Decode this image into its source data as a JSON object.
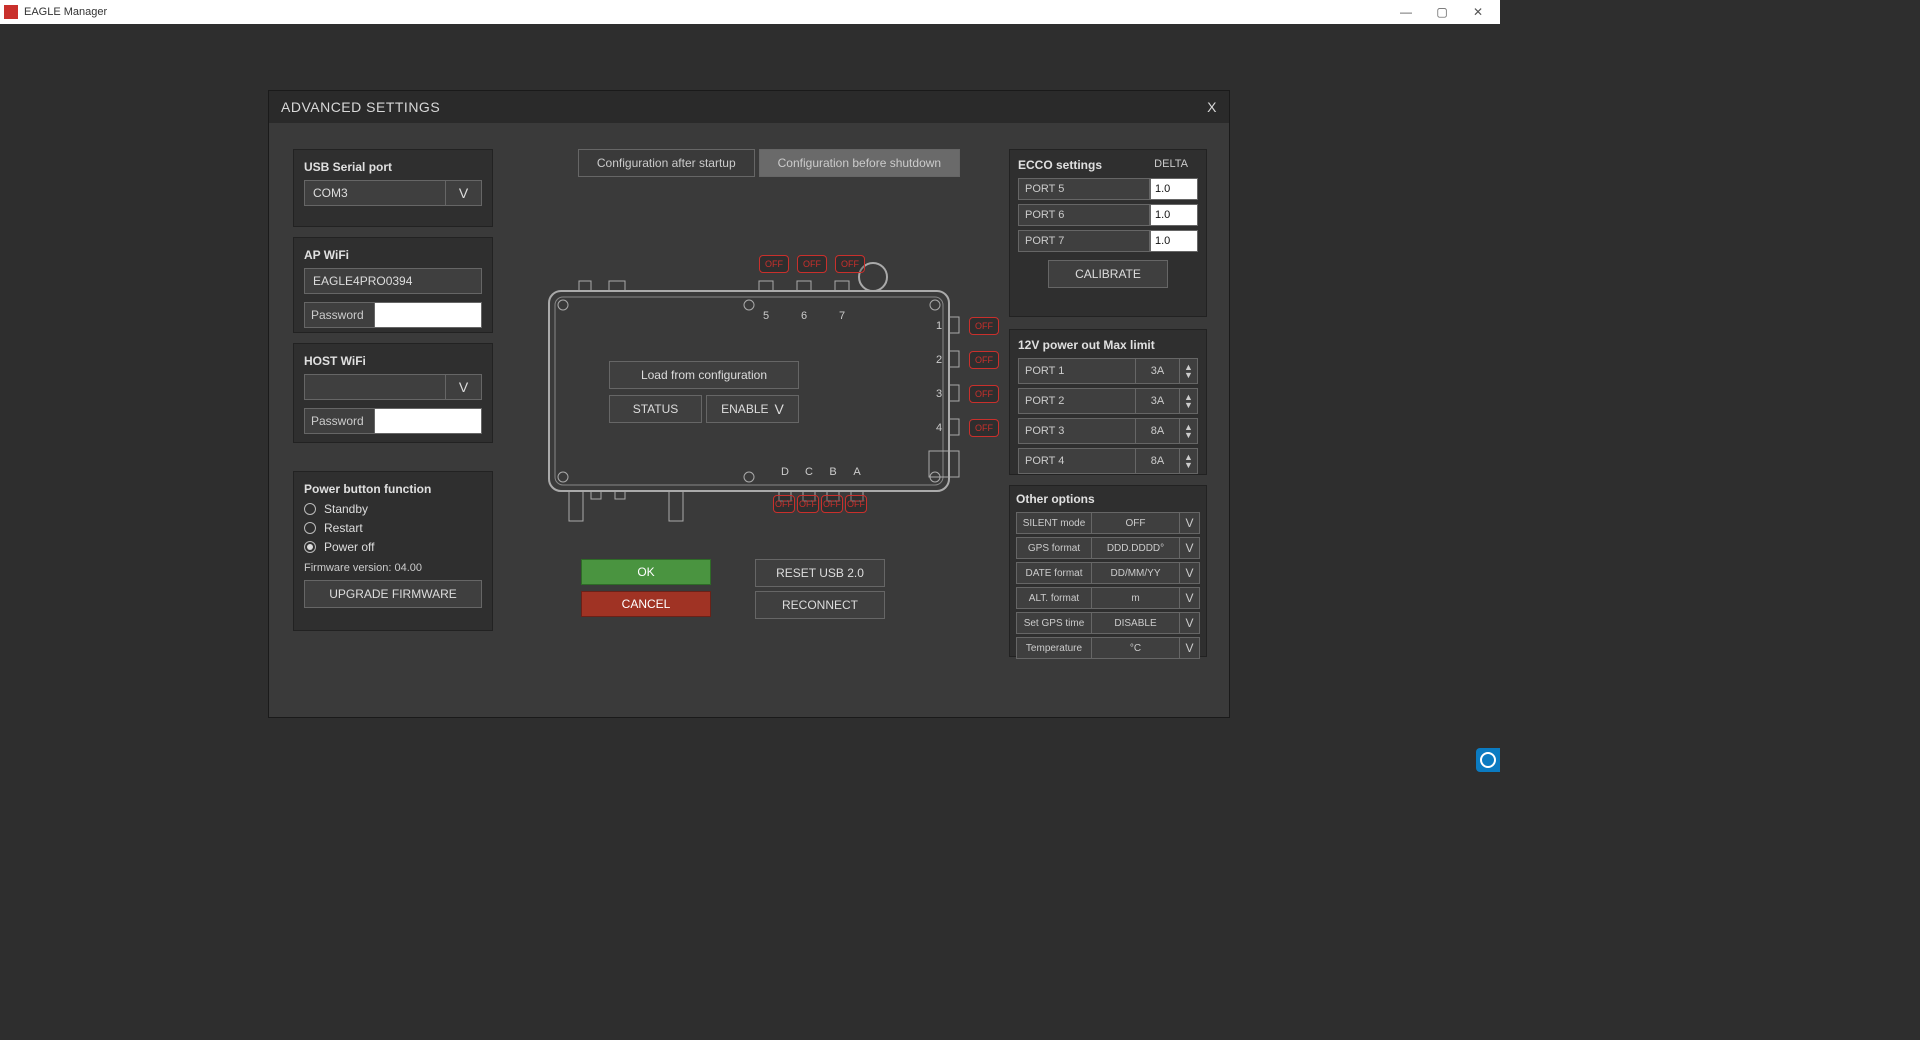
{
  "window": {
    "title": "EAGLE Manager"
  },
  "dialog": {
    "title": "ADVANCED SETTINGS",
    "close": "X"
  },
  "usb": {
    "label": "USB Serial port",
    "value": "COM3"
  },
  "apwifi": {
    "label": "AP WiFi",
    "ssid": "EAGLE4PRO0394",
    "password_label": "Password"
  },
  "hostwifi": {
    "label": "HOST WiFi",
    "ssid": "",
    "password_label": "Password"
  },
  "power_button": {
    "label": "Power button function",
    "options": [
      "Standby",
      "Restart",
      "Power off"
    ],
    "selected": 2
  },
  "firmware": {
    "line": "Firmware version: 04.00",
    "upgrade": "UPGRADE FIRMWARE"
  },
  "tabs": {
    "a": "Configuration after startup",
    "b": "Configuration before shutdown"
  },
  "center": {
    "load": "Load from configuration",
    "status": "STATUS",
    "enable": "ENABLE"
  },
  "device": {
    "top_ports": [
      "5",
      "6",
      "7"
    ],
    "right_ports": [
      "1",
      "2",
      "3",
      "4"
    ],
    "bottom_ports": [
      "D",
      "C",
      "B",
      "A"
    ],
    "off": "OFF"
  },
  "buttons": {
    "ok": "OK",
    "cancel": "CANCEL",
    "reset": "RESET USB 2.0",
    "reconnect": "RECONNECT"
  },
  "ecco": {
    "label": "ECCO settings",
    "delta": "DELTA",
    "rows": [
      {
        "label": "PORT 5",
        "value": "1.0"
      },
      {
        "label": "PORT 6",
        "value": "1.0"
      },
      {
        "label": "PORT 7",
        "value": "1.0"
      }
    ],
    "calibrate": "CALIBRATE"
  },
  "power_out": {
    "label": "12V power out Max limit",
    "rows": [
      {
        "label": "PORT 1",
        "value": "3A"
      },
      {
        "label": "PORT 2",
        "value": "3A"
      },
      {
        "label": "PORT 3",
        "value": "8A"
      },
      {
        "label": "PORT 4",
        "value": "8A"
      }
    ]
  },
  "other": {
    "label": "Other options",
    "rows": [
      {
        "label": "SILENT mode",
        "value": "OFF"
      },
      {
        "label": "GPS format",
        "value": "DDD.DDDD°"
      },
      {
        "label": "DATE format",
        "value": "DD/MM/YY"
      },
      {
        "label": "ALT. format",
        "value": "m"
      },
      {
        "label": "Set GPS time",
        "value": "DISABLE"
      },
      {
        "label": "Temperature",
        "value": "°C"
      }
    ]
  }
}
